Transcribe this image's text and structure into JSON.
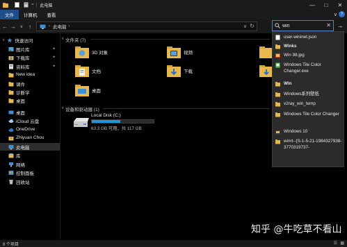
{
  "titlebar": {
    "title": "此电脑",
    "minimize": "—",
    "maximize": "□",
    "close": "✕"
  },
  "ribbon": {
    "tabs": [
      "文件",
      "计算机",
      "查看"
    ],
    "collapse": "∨",
    "help": "?"
  },
  "address": {
    "path": "此电脑",
    "dropdown": "∨",
    "refresh": "↻"
  },
  "search": {
    "value": "win",
    "clear": "✕",
    "go": "→"
  },
  "sidebar": {
    "items": [
      {
        "label": "快速访问",
        "icon": "star-icon",
        "pinned": false
      },
      {
        "label": "图片库",
        "icon": "pictures-icon",
        "pinned": true
      },
      {
        "label": "下载库",
        "icon": "download-icon",
        "pinned": true
      },
      {
        "label": "资料库",
        "icon": "document-icon",
        "pinned": true
      },
      {
        "label": "New idea",
        "icon": "folder-icon",
        "pinned": false
      },
      {
        "label": "课件",
        "icon": "folder-icon",
        "pinned": false
      },
      {
        "label": "诊断学",
        "icon": "folder-icon",
        "pinned": false
      },
      {
        "label": "桌面",
        "icon": "folder-icon",
        "pinned": false
      },
      {
        "label": "桌面",
        "icon": "desktop-icon",
        "pinned": false
      },
      {
        "label": "iCloud 云盘",
        "icon": "icloud-icon",
        "pinned": false
      },
      {
        "label": "OneDrive",
        "icon": "onedrive-icon",
        "pinned": false
      },
      {
        "label": "Zhiyuan Chou",
        "icon": "user-icon",
        "pinned": false
      },
      {
        "label": "此电脑",
        "icon": "computer-icon",
        "pinned": false
      },
      {
        "label": "库",
        "icon": "library-icon",
        "pinned": false
      },
      {
        "label": "网络",
        "icon": "network-icon",
        "pinned": false
      },
      {
        "label": "控制面板",
        "icon": "control-panel-icon",
        "pinned": false
      },
      {
        "label": "回收站",
        "icon": "recycle-bin-icon",
        "pinned": false
      }
    ]
  },
  "content": {
    "folders_group": "文件夹 (7)",
    "folders": [
      {
        "label": "3D 对象",
        "icon": "3d-objects-icon"
      },
      {
        "label": "视频",
        "icon": "videos-icon"
      },
      {
        "label": "",
        "icon": "folder-icon"
      },
      {
        "label": "文档",
        "icon": "documents-icon"
      },
      {
        "label": "下载",
        "icon": "downloads-icon"
      },
      {
        "label": "",
        "icon": "folder-icon"
      },
      {
        "label": "桌面",
        "icon": "desktop-folder-icon"
      }
    ],
    "devices_group": "设备和驱动器 (1)",
    "drive": {
      "label": "Local Disk (C:)",
      "size_text": "63.3 GB 可用，共 117 GB",
      "used_fraction": 0.46
    }
  },
  "suggestions": [
    {
      "text": "user-wininet.json",
      "icon": "file-icon"
    },
    {
      "text": "Winks",
      "icon": "folder-icon"
    },
    {
      "text": "Win 98.jpg",
      "icon": "image-icon"
    },
    {
      "text": "Windows Tile Color Changer.exe",
      "icon": "exe-icon"
    },
    {
      "text": "Win",
      "icon": "folder-icon"
    },
    {
      "text": "Windows系列壁纸",
      "icon": "folder-icon"
    },
    {
      "text": "v2ray_win_temp",
      "icon": "folder-icon"
    },
    {
      "text": "Windows Tile Color Changer",
      "icon": "folder-icon"
    },
    {
      "text": "Windows 10",
      "icon": "folder-icon"
    },
    {
      "text": "winrt--{S-1-5-21-1984327938-3770319737-",
      "icon": "folder-icon"
    }
  ],
  "status": {
    "text": "8 个项目"
  },
  "watermark": {
    "text": "知乎 @牛吃草不看山"
  },
  "colors": {
    "accent": "#1f4e8c",
    "drive_fill": "#2593d9",
    "folder": "#e8b84b",
    "background": "#000000"
  }
}
